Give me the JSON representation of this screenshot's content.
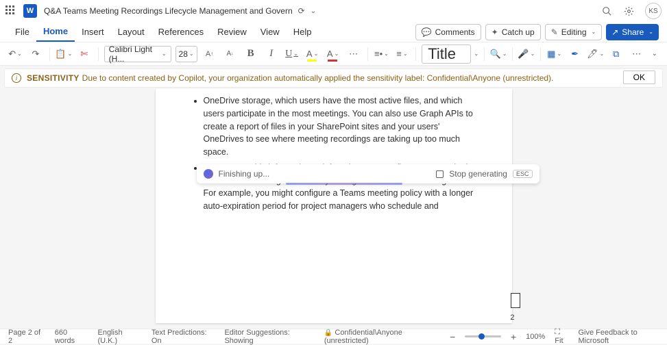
{
  "titlebar": {
    "word_icon": "W",
    "doc_title": "Q&A Teams Meeting Recordings Lifecycle Management and Govern",
    "avatar": "KS"
  },
  "menu": {
    "tabs": [
      "File",
      "Home",
      "Insert",
      "Layout",
      "References",
      "Review",
      "View",
      "Help"
    ],
    "active_index": 1,
    "comments": "Comments",
    "catch_up": "Catch up",
    "editing": "Editing",
    "share": "Share"
  },
  "ribbon": {
    "font_name": "Calibri Light (H...",
    "font_size": "28",
    "style_label": "Title"
  },
  "sensitivity": {
    "label": "SENSITIVITY",
    "message": "Due to content created by Copilot, your organization automatically applied the sensitivity label: Confidential\\Anyone (unrestricted).",
    "ok": "OK"
  },
  "document": {
    "bullets": [
      "OneDrive storage, which users have the most active files, and which users participate in the most meetings. You can also use Graph APIs to create a report of files in your SharePoint sites and your users' OneDrives to see where meeting recordings are taking up too much space.",
      "You can use this information to inform how you configure auto-expiration and retention settings based on your organization's needs and goals. For example, you might configure a Teams meeting policy with a longer auto-expiration period for project managers who schedule and"
    ],
    "page_number": "2"
  },
  "copilot": {
    "status": "Finishing up...",
    "stop": "Stop generating",
    "esc": "ESC"
  },
  "status": {
    "page": "Page 2 of 2",
    "words": "660 words",
    "language": "English (U.K.)",
    "predictions": "Text Predictions: On",
    "suggestions": "Editor Suggestions: Showing",
    "sensitivity": "Confidential\\Anyone (unrestricted)",
    "zoom_minus": "−",
    "zoom_plus": "+",
    "zoom_pct": "100%",
    "fit": "Fit",
    "feedback": "Give Feedback to Microsoft"
  }
}
